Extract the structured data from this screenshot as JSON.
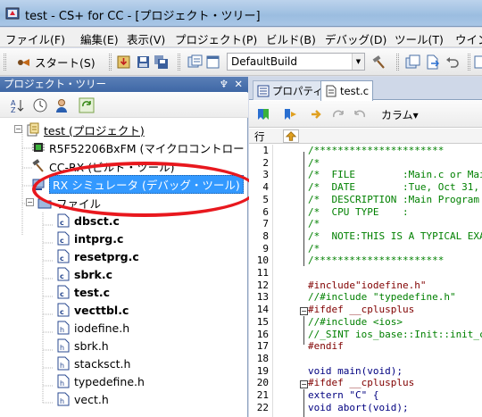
{
  "window": {
    "title": "test - CS+ for CC - [プロジェクト・ツリー]"
  },
  "menu": [
    "ファイル(F)",
    "編集(E)",
    "表示(V)",
    "プロジェクト(P)",
    "ビルド(B)",
    "デバッグ(D)",
    "ツール(T)",
    "ウイン"
  ],
  "toolbar": {
    "start_label": "スタート(S)",
    "build_config": "DefaultBuild"
  },
  "tree_panel": {
    "title": "プロジェクト・ツリー",
    "items": [
      {
        "label": "test (プロジェクト)",
        "underline": true
      },
      {
        "label": "R5F52206BxFM (マイクロコントロー"
      },
      {
        "label": "CC-RX (ビルド・ツール)"
      },
      {
        "label": "RX シミュレータ (デバッグ・ツール)"
      },
      {
        "label": "ファイル"
      },
      {
        "label": "dbsct.c",
        "bold": true
      },
      {
        "label": "intprg.c",
        "bold": true
      },
      {
        "label": "resetprg.c",
        "bold": true
      },
      {
        "label": "sbrk.c",
        "bold": true
      },
      {
        "label": "test.c",
        "bold": true
      },
      {
        "label": "vecttbl.c",
        "bold": true
      },
      {
        "label": "iodefine.h"
      },
      {
        "label": "sbrk.h"
      },
      {
        "label": "stacksct.h"
      },
      {
        "label": "typedefine.h"
      },
      {
        "label": "vect.h"
      }
    ]
  },
  "editor": {
    "tabs": [
      "プロパティ",
      "test.c"
    ],
    "column_label": "カラム▾",
    "row_header": "行",
    "lines": [
      {
        "n": "1",
        "text": "/**********************",
        "color": "#008000"
      },
      {
        "n": "2",
        "text": "/*",
        "color": "#008000"
      },
      {
        "n": "3",
        "text": "/*  FILE        :Main.c or Mai",
        "color": "#008000"
      },
      {
        "n": "4",
        "text": "/*  DATE        :Tue, Oct 31,",
        "color": "#008000"
      },
      {
        "n": "5",
        "text": "/*  DESCRIPTION :Main Program",
        "color": "#008000"
      },
      {
        "n": "6",
        "text": "/*  CPU TYPE    :",
        "color": "#008000"
      },
      {
        "n": "7",
        "text": "/*",
        "color": "#008000"
      },
      {
        "n": "8",
        "text": "/*  NOTE:THIS IS A TYPICAL EXA",
        "color": "#008000"
      },
      {
        "n": "9",
        "text": "/*",
        "color": "#008000"
      },
      {
        "n": "10",
        "text": "/**********************",
        "color": "#008000"
      },
      {
        "n": "11",
        "text": "",
        "color": "#000000"
      },
      {
        "n": "12",
        "text": "#include\"iodefine.h\"",
        "color": "#800000"
      },
      {
        "n": "13",
        "text": "//#include \"typedefine.h\"",
        "color": "#008000"
      },
      {
        "n": "14",
        "text": "#ifdef __cplusplus",
        "color": "#800000"
      },
      {
        "n": "15",
        "text": "//#include <ios>",
        "color": "#008000"
      },
      {
        "n": "16",
        "text": "//_SINT ios_base::Init::init_c",
        "color": "#008000"
      },
      {
        "n": "17",
        "text": "#endif",
        "color": "#800000"
      },
      {
        "n": "18",
        "text": "",
        "color": "#000000"
      },
      {
        "n": "19",
        "text": "void main(void);",
        "color": "#000080"
      },
      {
        "n": "20",
        "text": "#ifdef __cplusplus",
        "color": "#800000"
      },
      {
        "n": "21",
        "text": "extern \"C\" {",
        "color": "#000080"
      },
      {
        "n": "22",
        "text": "void abort(void);",
        "color": "#000080"
      }
    ]
  }
}
